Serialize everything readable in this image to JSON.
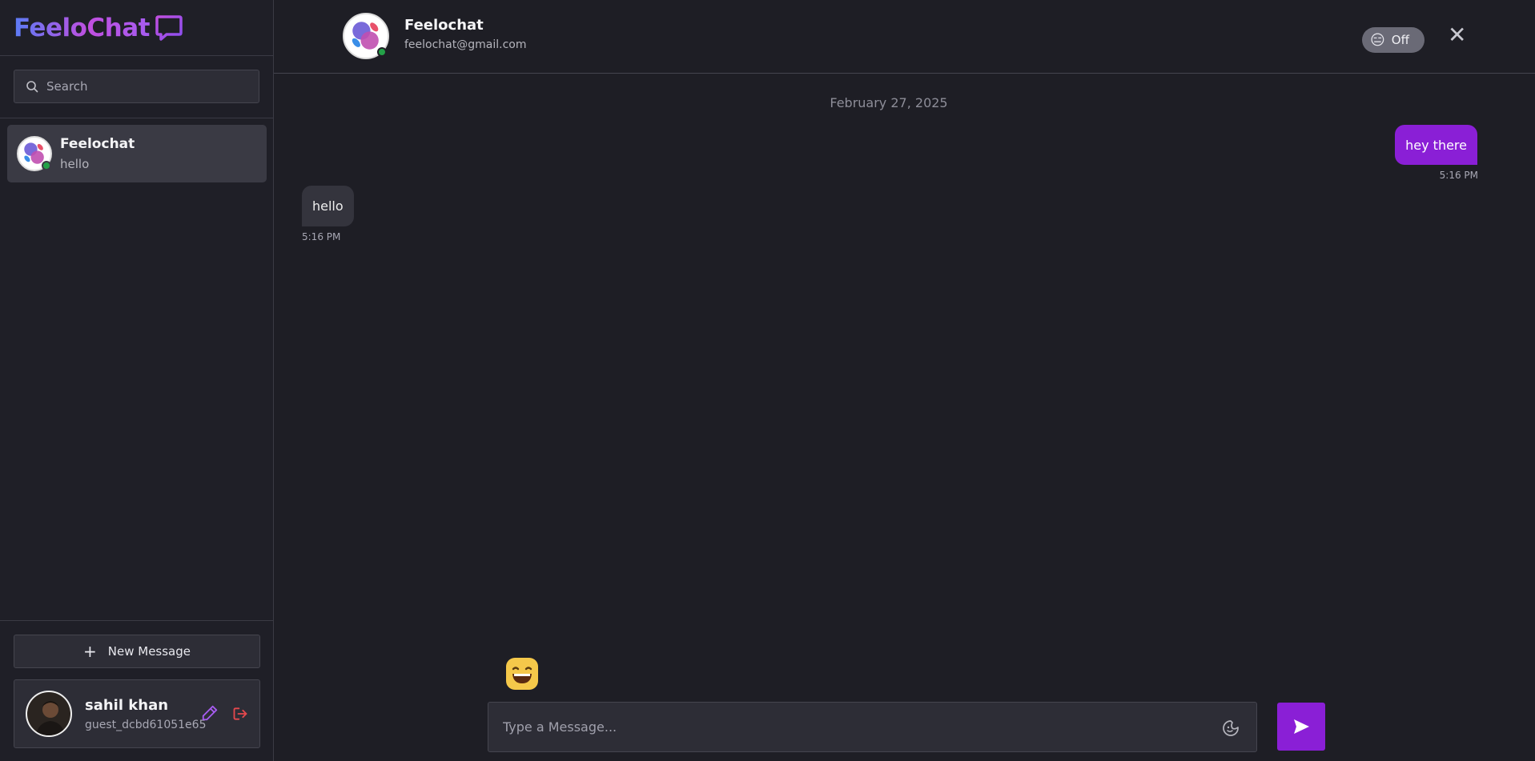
{
  "app": {
    "title_part1": "Feelo",
    "title_part2": "Chat"
  },
  "search": {
    "placeholder": "Search"
  },
  "contacts": [
    {
      "name": "Feelochat",
      "preview": "hello",
      "online": true
    }
  ],
  "sidebar_footer": {
    "new_message_label": "New Message",
    "profile": {
      "name": "sahil khan",
      "id": "guest_dcbd61051e65"
    }
  },
  "chat": {
    "header": {
      "name": "Feelochat",
      "email": "feelochat@gmail.com"
    },
    "toggle": {
      "emoji": "😑",
      "label": "Off"
    },
    "date_separator": "February 27, 2025",
    "messages": [
      {
        "direction": "outgoing",
        "text": "hey there",
        "time": "5:16 PM"
      },
      {
        "direction": "incoming",
        "text": "hello",
        "time": "5:16 PM"
      }
    ],
    "composer": {
      "placeholder": "Type a Message..."
    }
  },
  "colors": {
    "accent": "#8a1fd6",
    "online": "#24a148",
    "background": "#1e1e25",
    "logout": "#e5484d"
  },
  "icons": [
    "search-icon",
    "chat-bubble-icon",
    "plus-icon",
    "edit-icon",
    "logout-icon",
    "close-icon",
    "sticker-icon",
    "send-icon",
    "emoji-icon"
  ]
}
